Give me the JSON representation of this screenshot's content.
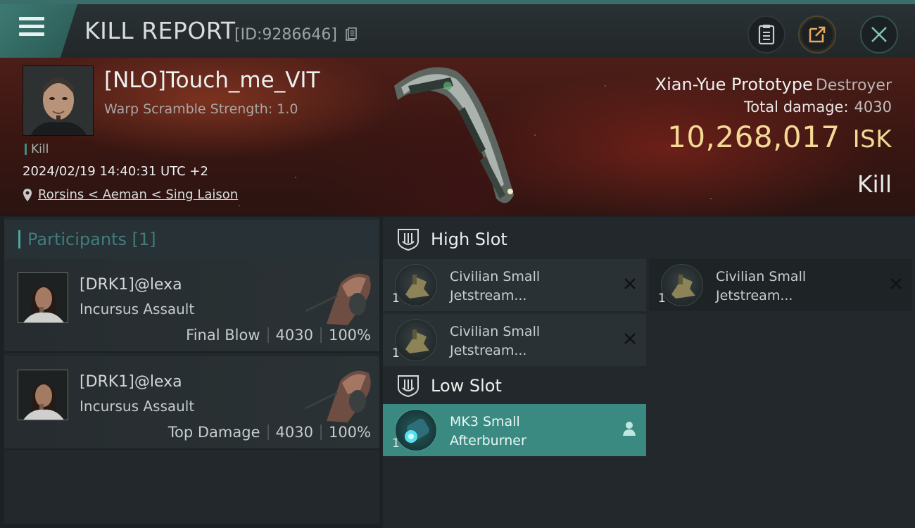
{
  "header": {
    "title": "KILL REPORT",
    "report_id": "[ID:9286646]"
  },
  "victim": {
    "name": "[NLO]Touch_me_VIT",
    "warp_scramble": "Warp Scramble Strength: 1.0",
    "tag": "Kill",
    "datetime": "2024/02/19 14:40:31 UTC +2",
    "location": "Rorsins < Aeman < Sing Laison",
    "ship_name": "Xian-Yue Prototype",
    "ship_class": "Destroyer",
    "total_damage_label": "Total damage:",
    "total_damage": "4030",
    "isk_value": "10,268,017",
    "isk_unit": "ISK",
    "result": "Kill"
  },
  "participants": {
    "label": "Participants",
    "count": "[1]",
    "list": [
      {
        "name": "[DRK1]@lexa",
        "ship": "Incursus Assault",
        "role": "Final Blow",
        "damage": "4030",
        "percent": "100%"
      },
      {
        "name": "[DRK1]@lexa",
        "ship": "Incursus Assault",
        "role": "Top Damage",
        "damage": "4030",
        "percent": "100%"
      }
    ]
  },
  "fitting": {
    "high_slot_label": "High Slot",
    "low_slot_label": "Low Slot",
    "high_slots": [
      {
        "name_line1": "Civilian Small",
        "name_line2": "Jetstream...",
        "qty": "1"
      },
      {
        "name_line1": "Civilian Small",
        "name_line2": "Jetstream...",
        "qty": "1"
      },
      {
        "name_line1": "Civilian Small",
        "name_line2": "Jetstream...",
        "qty": "1"
      }
    ],
    "low_slots": [
      {
        "name_line1": "MK3 Small",
        "name_line2": "Afterburner",
        "qty": "1"
      }
    ]
  },
  "colors": {
    "accent_teal": "#3a8a82",
    "isk_gold": "#f3d995",
    "panel": "#22282b"
  },
  "icons": [
    "menu-icon",
    "copy-icon",
    "clipboard-icon",
    "share-icon",
    "close-icon",
    "location-pin-icon",
    "slot-shield-icon",
    "destroyed-x-icon",
    "pilot-icon"
  ]
}
